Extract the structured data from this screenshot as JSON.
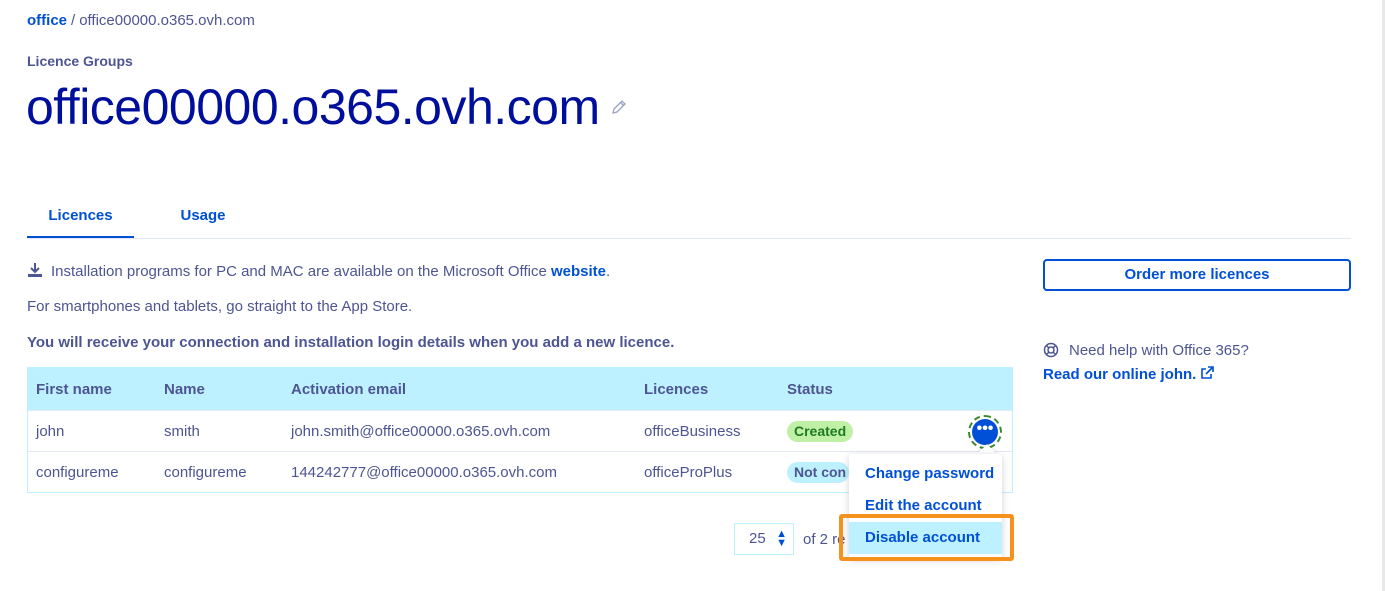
{
  "breadcrumb": {
    "root": "office",
    "separator": "/",
    "current": "office00000.o365.ovh.com"
  },
  "header": {
    "eyebrow": "Licence Groups",
    "title": "office00000.o365.ovh.com"
  },
  "tabs": [
    {
      "label": "Licences",
      "active": true
    },
    {
      "label": "Usage",
      "active": false
    }
  ],
  "info": {
    "line1_text": "Installation programs for PC and MAC are available on the Microsoft Office ",
    "line1_link": "website",
    "line1_end": ".",
    "line2": "For smartphones and tablets, go straight to the App Store.",
    "line3": "You will receive your connection and installation login details when you add a new licence."
  },
  "table": {
    "headers": [
      "First name",
      "Name",
      "Activation email",
      "Licences",
      "Status"
    ],
    "rows": [
      {
        "first_name": "john",
        "name": "smith",
        "email": "john.smith@office00000.o365.ovh.com",
        "licence": "officeBusiness",
        "status": "Created"
      },
      {
        "first_name": "configureme",
        "name": "configureme",
        "email": "144242777@office00000.o365.ovh.com",
        "licence": "officeProPlus",
        "status": "Not con"
      }
    ],
    "actions_label": "•••"
  },
  "action_menu": {
    "items": [
      "Change password",
      "Edit the account",
      "Disable account"
    ],
    "highlighted": "Disable account"
  },
  "pagination": {
    "page_size": "25",
    "text": "of 2 re"
  },
  "sidebar": {
    "order_button": "Order more licences",
    "help_text": "Need help with Office 365?",
    "help_link": "Read our online john."
  },
  "colors": {
    "accent": "#0050d7",
    "title": "#000e9c",
    "text": "#4d5592",
    "header_bg": "#bef1ff",
    "highlight": "#f7911e",
    "success_bg": "#c0f0a6"
  }
}
